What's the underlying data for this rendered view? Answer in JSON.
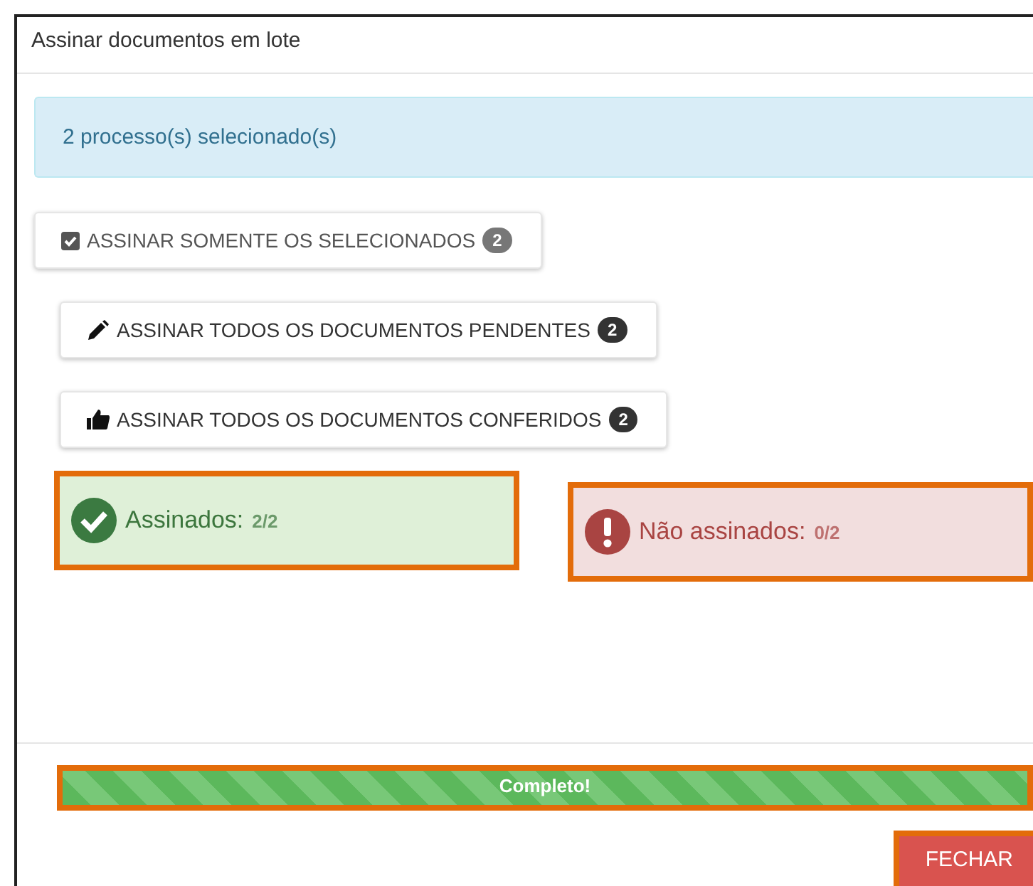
{
  "dialog": {
    "title": "Assinar documentos em lote"
  },
  "alert": "2 processo(s) selecionado(s)",
  "actions": [
    {
      "kind": "checkbox",
      "label": "ASSINAR SOMENTE OS SELECIONADOS",
      "count": "2",
      "checked": true
    },
    {
      "kind": "pen",
      "label": "ASSINAR TODOS OS DOCUMENTOS PENDENTES",
      "count": "2"
    },
    {
      "kind": "thumb",
      "label": "ASSINAR TODOS OS DOCUMENTOS CONFERIDOS",
      "count": "2"
    }
  ],
  "results": [
    {
      "kind": "success",
      "label": "Assinados:",
      "value": "2/2"
    },
    {
      "kind": "error",
      "label": "Não assinados:",
      "value": "0/2"
    }
  ],
  "progress": {
    "label": "Completo!",
    "level": 1
  },
  "close_button": "FECHAR"
}
